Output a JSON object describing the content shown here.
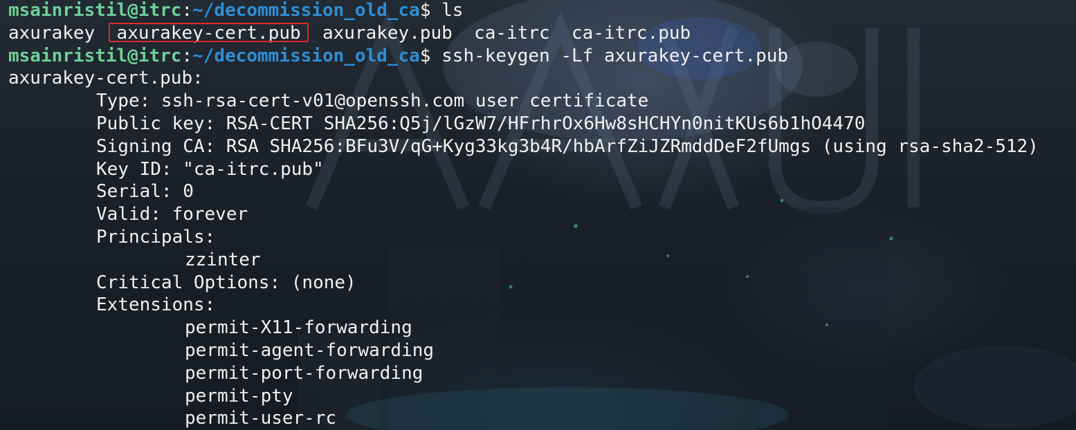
{
  "prompt": {
    "user": "msainristil@itrc",
    "separator": ":",
    "path": "~/decommission_old_ca",
    "symbol": "$"
  },
  "commands": {
    "ls": "ls",
    "keygen": "ssh-keygen -Lf axurakey-cert.pub"
  },
  "ls_output": {
    "files": [
      "axurakey",
      "axurakey-cert.pub",
      "axurakey.pub",
      "ca-itrc",
      "ca-itrc.pub"
    ]
  },
  "cert": {
    "header": "axurakey-cert.pub:",
    "type": "Type: ssh-rsa-cert-v01@openssh.com user certificate",
    "public_key": "Public key: RSA-CERT SHA256:Q5j/lGzW7/HFrhrOx6Hw8sHCHYn0nitKUs6b1hO4470",
    "signing_ca": "Signing CA: RSA SHA256:BFu3V/qG+Kyg33kg3b4R/hbArfZiJZRmddDeF2fUmgs (using rsa-sha2-512)",
    "key_id": "Key ID: \"ca-itrc.pub\"",
    "serial": "Serial: 0",
    "valid": "Valid: forever",
    "principals_label": "Principals:",
    "principals": [
      "zzinter"
    ],
    "critical_options": "Critical Options: (none)",
    "extensions_label": "Extensions:",
    "extensions": [
      "permit-X11-forwarding",
      "permit-agent-forwarding",
      "permit-port-forwarding",
      "permit-pty",
      "permit-user-rc"
    ]
  },
  "colors": {
    "user": "#6fcf97",
    "path": "#2e8fd6",
    "text": "#f2f2f2",
    "highlight_box": "#e0282a",
    "background": "#1b2128"
  }
}
